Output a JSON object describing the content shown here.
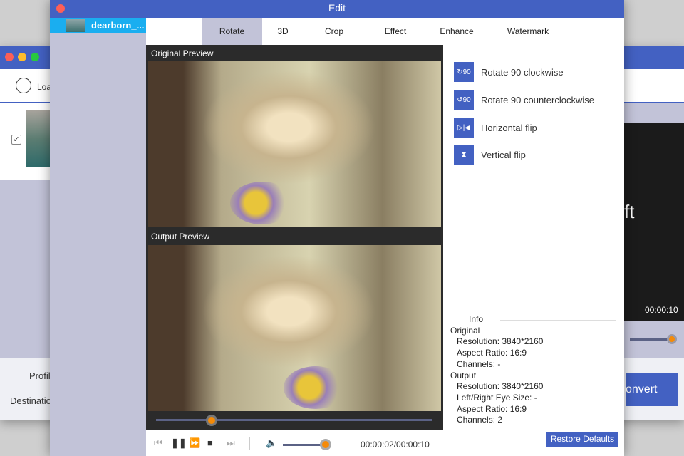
{
  "back_window": {
    "load_label": "Loa",
    "profile_label": "Profil",
    "destination_label": "Destinatio",
    "preview_text": "ft",
    "time": "00:00:10",
    "convert_label": "onvert"
  },
  "edit_window": {
    "title": "Edit",
    "file": {
      "name": "dearborn_..."
    },
    "tabs": [
      {
        "label": "Rotate",
        "active": true
      },
      {
        "label": "3D"
      },
      {
        "label": "Crop"
      },
      {
        "label": "Effect"
      },
      {
        "label": "Enhance"
      },
      {
        "label": "Watermark"
      }
    ],
    "original_preview_label": "Original Preview",
    "output_preview_label": "Output Preview",
    "playback": {
      "progress": 0.2,
      "volume": 1.0,
      "time": "00:00:02/00:00:10"
    },
    "options": [
      {
        "label": "Rotate 90 clockwise",
        "icon": "rotate-cw-icon"
      },
      {
        "label": "Rotate 90 counterclockwise",
        "icon": "rotate-ccw-icon"
      },
      {
        "label": "Horizontal flip",
        "icon": "flip-horizontal-icon"
      },
      {
        "label": "Vertical flip",
        "icon": "flip-vertical-icon"
      }
    ],
    "info": {
      "title": "Info",
      "original": "Original",
      "orig_res": "Resolution: 3840*2160",
      "orig_ar": "Aspect Ratio: 16:9",
      "orig_ch": "Channels: -",
      "output": "Output",
      "out_res": "Resolution: 3840*2160",
      "out_eye": "Left/Right Eye Size: -",
      "out_ar": "Aspect Ratio: 16:9",
      "out_ch": "Channels: 2"
    },
    "restore_label": "Restore Defaults"
  }
}
